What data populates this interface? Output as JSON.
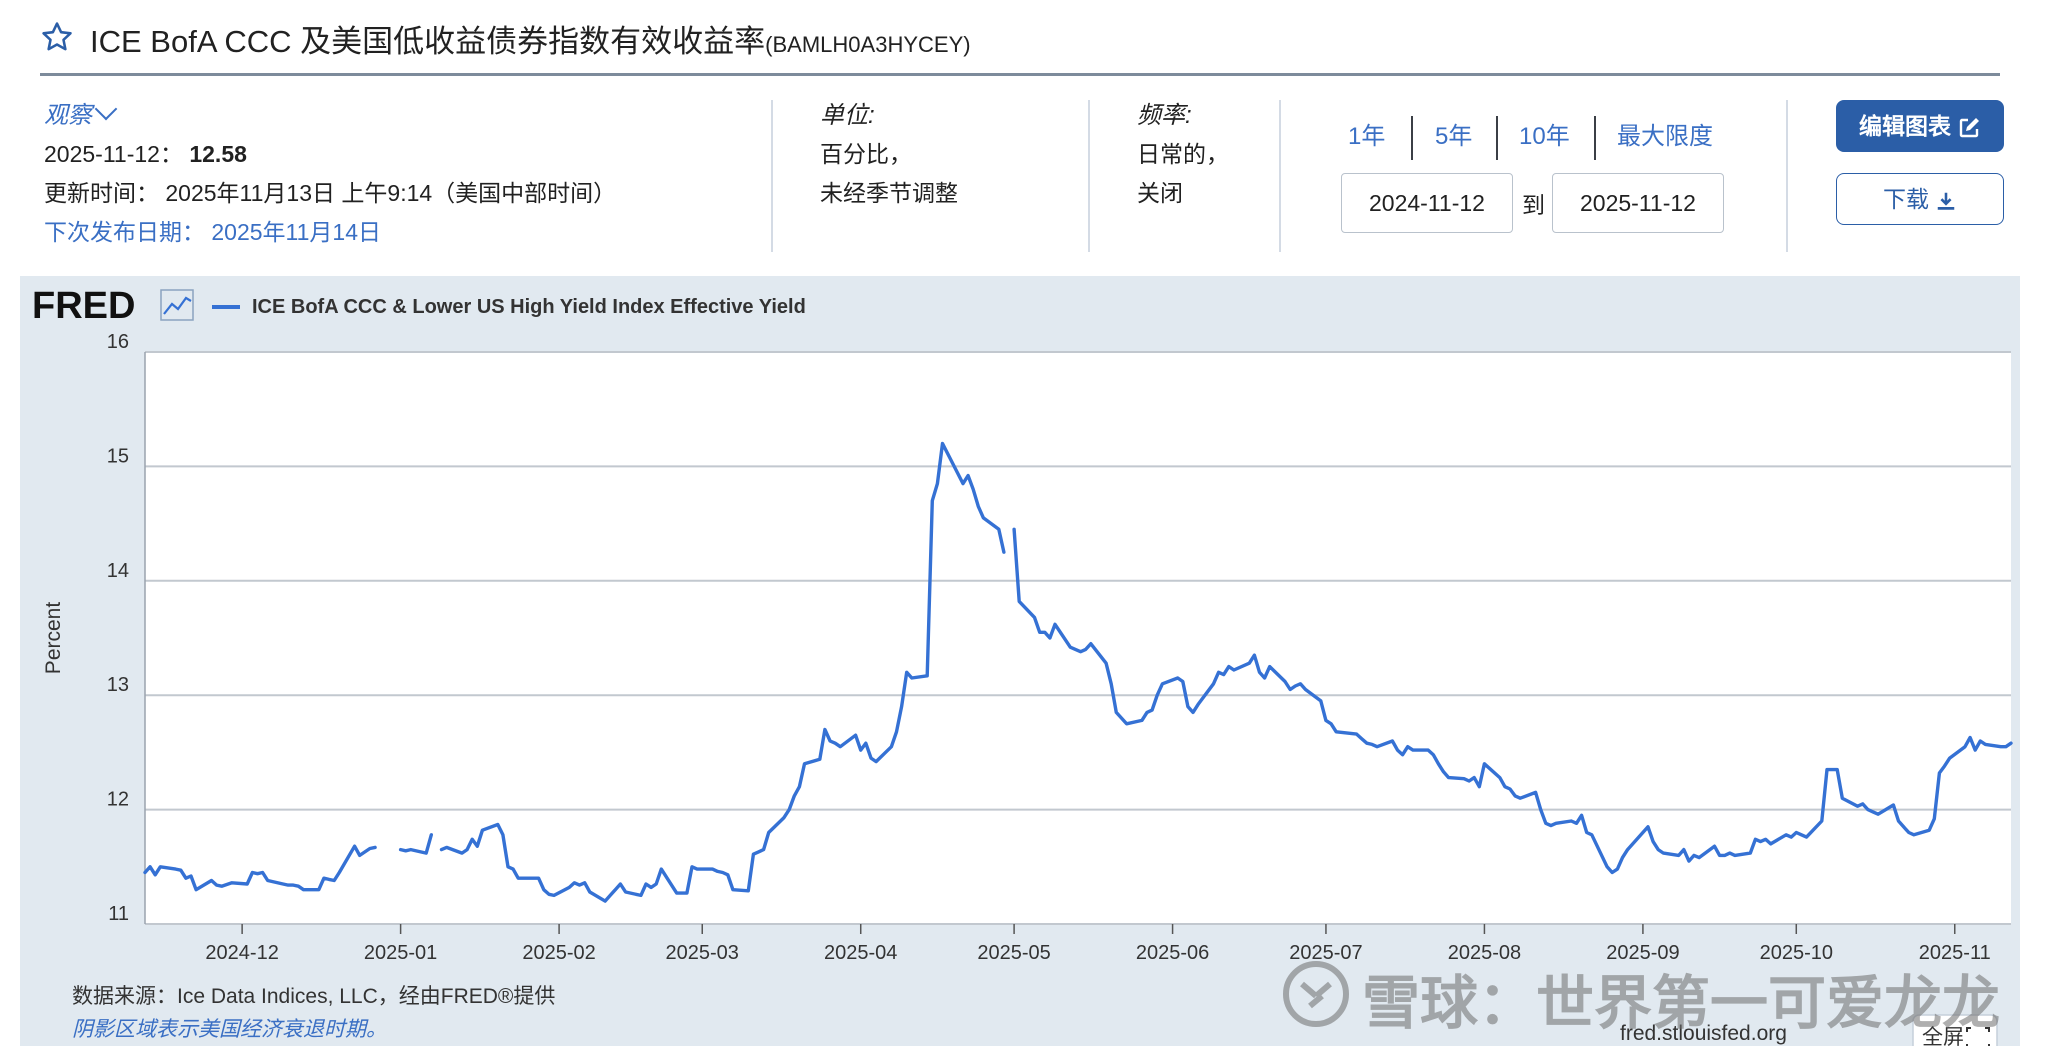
{
  "header": {
    "title": "ICE BofA CCC 及美国低收益债券指数有效收益率",
    "series_id": "(BAMLH0A3HYCEY)"
  },
  "observation": {
    "label": "观察",
    "date": "2025-11-12",
    "value": "12.58",
    "updated_label": "更新时间：",
    "updated_value": "2025年11月13日 上午9:14（美国中部时间）",
    "next_release_label": "下次发布日期：",
    "next_release_value": "2025年11月14日"
  },
  "units": {
    "label": "单位:",
    "line1": "百分比，",
    "line2": "未经季节调整"
  },
  "frequency": {
    "label": "频率:",
    "line1": "日常的，",
    "line2": "关闭"
  },
  "date_range": {
    "options": [
      "1年",
      "5年",
      "10年",
      "最大限度"
    ],
    "start": "2024-11-12",
    "to_label": "到",
    "end": "2025-11-12"
  },
  "buttons": {
    "edit": "编辑图表",
    "download": "下载"
  },
  "footer": {
    "source": "数据来源：Ice Data Indices, LLC，经由FRED®提供",
    "recession_note": "阴影区域表示美国经济衰退时期。",
    "site": "fred.stlouisfed.org",
    "fullscreen": "全屏"
  },
  "watermark": "雪球：世界第一可爱龙龙",
  "colors": {
    "line": "#3571d4",
    "accent": "#2b5ea7",
    "panel": "#e1e9f0",
    "link": "#3a6fc4"
  },
  "chart_data": {
    "type": "line",
    "brand": "FRED",
    "series": [
      {
        "name": "ICE BofA CCC & Lower US High Yield Index Effective Yield",
        "points": [
          [
            "2024-11-12",
            11.45
          ],
          [
            "2024-11-13",
            11.5
          ],
          [
            "2024-11-14",
            11.43
          ],
          [
            "2024-11-15",
            11.5
          ],
          [
            "2024-11-18",
            11.48
          ],
          [
            "2024-11-19",
            11.47
          ],
          [
            "2024-11-20",
            11.4
          ],
          [
            "2024-11-21",
            11.42
          ],
          [
            "2024-11-22",
            11.3
          ],
          [
            "2024-11-25",
            11.38
          ],
          [
            "2024-11-26",
            11.34
          ],
          [
            "2024-11-27",
            11.33
          ],
          [
            "2024-11-29",
            11.36
          ],
          [
            "2024-12-02",
            11.35
          ],
          [
            "2024-12-03",
            11.45
          ],
          [
            "2024-12-04",
            11.44
          ],
          [
            "2024-12-05",
            11.45
          ],
          [
            "2024-12-06",
            11.38
          ],
          [
            "2024-12-09",
            11.35
          ],
          [
            "2024-12-10",
            11.34
          ],
          [
            "2024-12-11",
            11.34
          ],
          [
            "2024-12-12",
            11.33
          ],
          [
            "2024-12-13",
            11.3
          ],
          [
            "2024-12-16",
            11.3
          ],
          [
            "2024-12-17",
            11.4
          ],
          [
            "2024-12-18",
            11.39
          ],
          [
            "2024-12-19",
            11.38
          ],
          [
            "2024-12-20",
            11.45
          ],
          [
            "2024-12-23",
            11.68
          ],
          [
            "2024-12-24",
            11.6
          ],
          [
            "2024-12-26",
            11.66
          ],
          [
            "2024-12-27",
            11.67
          ],
          [
            "2024-12-30",
            null
          ],
          [
            "2025-01-01",
            11.65
          ],
          [
            "2025-01-02",
            11.64
          ],
          [
            "2025-01-03",
            11.65
          ],
          [
            "2025-01-06",
            11.62
          ],
          [
            "2025-01-07",
            11.78
          ],
          [
            "2025-01-08",
            null
          ],
          [
            "2025-01-09",
            11.65
          ],
          [
            "2025-01-10",
            11.67
          ],
          [
            "2025-01-13",
            11.62
          ],
          [
            "2025-01-14",
            11.65
          ],
          [
            "2025-01-15",
            11.74
          ],
          [
            "2025-01-16",
            11.68
          ],
          [
            "2025-01-17",
            11.82
          ],
          [
            "2025-01-20",
            11.87
          ],
          [
            "2025-01-21",
            11.78
          ],
          [
            "2025-01-22",
            11.5
          ],
          [
            "2025-01-23",
            11.48
          ],
          [
            "2025-01-24",
            11.4
          ],
          [
            "2025-01-27",
            11.4
          ],
          [
            "2025-01-28",
            11.4
          ],
          [
            "2025-01-29",
            11.3
          ],
          [
            "2025-01-30",
            11.26
          ],
          [
            "2025-01-31",
            11.25
          ],
          [
            "2025-02-03",
            11.32
          ],
          [
            "2025-02-04",
            11.36
          ],
          [
            "2025-02-05",
            11.34
          ],
          [
            "2025-02-06",
            11.36
          ],
          [
            "2025-02-07",
            11.28
          ],
          [
            "2025-02-10",
            11.2
          ],
          [
            "2025-02-11",
            11.25
          ],
          [
            "2025-02-12",
            11.3
          ],
          [
            "2025-02-13",
            11.35
          ],
          [
            "2025-02-14",
            11.28
          ],
          [
            "2025-02-17",
            11.25
          ],
          [
            "2025-02-18",
            11.35
          ],
          [
            "2025-02-19",
            11.32
          ],
          [
            "2025-02-20",
            11.35
          ],
          [
            "2025-02-21",
            11.48
          ],
          [
            "2025-02-24",
            11.27
          ],
          [
            "2025-02-25",
            11.27
          ],
          [
            "2025-02-26",
            11.27
          ],
          [
            "2025-02-27",
            11.5
          ],
          [
            "2025-02-28",
            11.48
          ],
          [
            "2025-03-03",
            11.48
          ],
          [
            "2025-03-04",
            11.46
          ],
          [
            "2025-03-05",
            11.45
          ],
          [
            "2025-03-06",
            11.43
          ],
          [
            "2025-03-07",
            11.3
          ],
          [
            "2025-03-10",
            11.29
          ],
          [
            "2025-03-11",
            11.61
          ],
          [
            "2025-03-12",
            11.63
          ],
          [
            "2025-03-13",
            11.65
          ],
          [
            "2025-03-14",
            11.8
          ],
          [
            "2025-03-17",
            11.93
          ],
          [
            "2025-03-18",
            12.0
          ],
          [
            "2025-03-19",
            12.12
          ],
          [
            "2025-03-20",
            12.2
          ],
          [
            "2025-03-21",
            12.4
          ],
          [
            "2025-03-24",
            12.44
          ],
          [
            "2025-03-25",
            12.7
          ],
          [
            "2025-03-26",
            12.6
          ],
          [
            "2025-03-27",
            12.58
          ],
          [
            "2025-03-28",
            12.55
          ],
          [
            "2025-03-31",
            12.65
          ],
          [
            "2025-04-01",
            12.52
          ],
          [
            "2025-04-02",
            12.58
          ],
          [
            "2025-04-03",
            12.45
          ],
          [
            "2025-04-04",
            12.42
          ],
          [
            "2025-04-07",
            12.55
          ],
          [
            "2025-04-08",
            12.68
          ],
          [
            "2025-04-09",
            12.9
          ],
          [
            "2025-04-10",
            13.2
          ],
          [
            "2025-04-11",
            13.15
          ],
          [
            "2025-04-14",
            13.17
          ],
          [
            "2025-04-15",
            14.7
          ],
          [
            "2025-04-16",
            14.85
          ],
          [
            "2025-04-17",
            15.2
          ],
          [
            "2025-04-21",
            14.85
          ],
          [
            "2025-04-22",
            14.92
          ],
          [
            "2025-04-23",
            14.8
          ],
          [
            "2025-04-24",
            14.65
          ],
          [
            "2025-04-25",
            14.55
          ],
          [
            "2025-04-28",
            14.45
          ],
          [
            "2025-04-29",
            14.25
          ],
          [
            "2025-04-30",
            null
          ],
          [
            "2025-05-01",
            14.45
          ],
          [
            "2025-05-02",
            13.82
          ],
          [
            "2025-05-05",
            13.68
          ],
          [
            "2025-05-06",
            13.55
          ],
          [
            "2025-05-07",
            13.55
          ],
          [
            "2025-05-08",
            13.5
          ],
          [
            "2025-05-09",
            13.62
          ],
          [
            "2025-05-12",
            13.42
          ],
          [
            "2025-05-13",
            13.4
          ],
          [
            "2025-05-14",
            13.38
          ],
          [
            "2025-05-15",
            13.4
          ],
          [
            "2025-05-16",
            13.45
          ],
          [
            "2025-05-19",
            13.28
          ],
          [
            "2025-05-20",
            13.1
          ],
          [
            "2025-05-21",
            12.85
          ],
          [
            "2025-05-22",
            12.8
          ],
          [
            "2025-05-23",
            12.75
          ],
          [
            "2025-05-26",
            12.78
          ],
          [
            "2025-05-27",
            12.85
          ],
          [
            "2025-05-28",
            12.87
          ],
          [
            "2025-05-29",
            13.0
          ],
          [
            "2025-05-30",
            13.1
          ],
          [
            "2025-06-02",
            13.15
          ],
          [
            "2025-06-03",
            13.12
          ],
          [
            "2025-06-04",
            12.9
          ],
          [
            "2025-06-05",
            12.85
          ],
          [
            "2025-06-06",
            12.92
          ],
          [
            "2025-06-09",
            13.1
          ],
          [
            "2025-06-10",
            13.2
          ],
          [
            "2025-06-11",
            13.18
          ],
          [
            "2025-06-12",
            13.25
          ],
          [
            "2025-06-13",
            13.22
          ],
          [
            "2025-06-16",
            13.28
          ],
          [
            "2025-06-17",
            13.35
          ],
          [
            "2025-06-18",
            13.2
          ],
          [
            "2025-06-19",
            13.15
          ],
          [
            "2025-06-20",
            13.25
          ],
          [
            "2025-06-23",
            13.12
          ],
          [
            "2025-06-24",
            13.05
          ],
          [
            "2025-06-25",
            13.08
          ],
          [
            "2025-06-26",
            13.1
          ],
          [
            "2025-06-27",
            13.05
          ],
          [
            "2025-06-30",
            12.95
          ],
          [
            "2025-07-01",
            12.78
          ],
          [
            "2025-07-02",
            12.75
          ],
          [
            "2025-07-03",
            12.68
          ],
          [
            "2025-07-07",
            12.66
          ],
          [
            "2025-07-08",
            12.62
          ],
          [
            "2025-07-09",
            12.58
          ],
          [
            "2025-07-10",
            12.57
          ],
          [
            "2025-07-11",
            12.55
          ],
          [
            "2025-07-14",
            12.6
          ],
          [
            "2025-07-15",
            12.52
          ],
          [
            "2025-07-16",
            12.48
          ],
          [
            "2025-07-17",
            12.55
          ],
          [
            "2025-07-18",
            12.52
          ],
          [
            "2025-07-21",
            12.52
          ],
          [
            "2025-07-22",
            12.48
          ],
          [
            "2025-07-23",
            12.4
          ],
          [
            "2025-07-24",
            12.33
          ],
          [
            "2025-07-25",
            12.28
          ],
          [
            "2025-07-28",
            12.27
          ],
          [
            "2025-07-29",
            12.25
          ],
          [
            "2025-07-30",
            12.28
          ],
          [
            "2025-07-31",
            12.2
          ],
          [
            "2025-08-01",
            12.4
          ],
          [
            "2025-08-04",
            12.28
          ],
          [
            "2025-08-05",
            12.2
          ],
          [
            "2025-08-06",
            12.18
          ],
          [
            "2025-08-07",
            12.12
          ],
          [
            "2025-08-08",
            12.1
          ],
          [
            "2025-08-11",
            12.15
          ],
          [
            "2025-08-12",
            12.0
          ],
          [
            "2025-08-13",
            11.88
          ],
          [
            "2025-08-14",
            11.86
          ],
          [
            "2025-08-15",
            11.88
          ],
          [
            "2025-08-18",
            11.9
          ],
          [
            "2025-08-19",
            11.88
          ],
          [
            "2025-08-20",
            11.95
          ],
          [
            "2025-08-21",
            11.8
          ],
          [
            "2025-08-22",
            11.78
          ],
          [
            "2025-08-25",
            11.5
          ],
          [
            "2025-08-26",
            11.45
          ],
          [
            "2025-08-27",
            11.48
          ],
          [
            "2025-08-28",
            11.58
          ],
          [
            "2025-08-29",
            11.65
          ],
          [
            "2025-09-02",
            11.85
          ],
          [
            "2025-09-03",
            11.72
          ],
          [
            "2025-09-04",
            11.65
          ],
          [
            "2025-09-05",
            11.62
          ],
          [
            "2025-09-08",
            11.6
          ],
          [
            "2025-09-09",
            11.65
          ],
          [
            "2025-09-10",
            11.55
          ],
          [
            "2025-09-11",
            11.6
          ],
          [
            "2025-09-12",
            11.58
          ],
          [
            "2025-09-15",
            11.68
          ],
          [
            "2025-09-16",
            11.6
          ],
          [
            "2025-09-17",
            11.6
          ],
          [
            "2025-09-18",
            11.62
          ],
          [
            "2025-09-19",
            11.6
          ],
          [
            "2025-09-22",
            11.62
          ],
          [
            "2025-09-23",
            11.74
          ],
          [
            "2025-09-24",
            11.72
          ],
          [
            "2025-09-25",
            11.74
          ],
          [
            "2025-09-26",
            11.7
          ],
          [
            "2025-09-29",
            11.78
          ],
          [
            "2025-09-30",
            11.76
          ],
          [
            "2025-10-01",
            11.8
          ],
          [
            "2025-10-02",
            11.78
          ],
          [
            "2025-10-03",
            11.76
          ],
          [
            "2025-10-06",
            11.9
          ],
          [
            "2025-10-07",
            12.35
          ],
          [
            "2025-10-08",
            12.35
          ],
          [
            "2025-10-09",
            12.35
          ],
          [
            "2025-10-10",
            12.1
          ],
          [
            "2025-10-13",
            12.03
          ],
          [
            "2025-10-14",
            12.05
          ],
          [
            "2025-10-15",
            12.0
          ],
          [
            "2025-10-16",
            11.98
          ],
          [
            "2025-10-17",
            11.96
          ],
          [
            "2025-10-20",
            12.04
          ],
          [
            "2025-10-21",
            11.9
          ],
          [
            "2025-10-22",
            11.85
          ],
          [
            "2025-10-23",
            11.8
          ],
          [
            "2025-10-24",
            11.78
          ],
          [
            "2025-10-27",
            11.82
          ],
          [
            "2025-10-28",
            11.92
          ],
          [
            "2025-10-29",
            12.32
          ],
          [
            "2025-10-30",
            12.38
          ],
          [
            "2025-10-31",
            12.45
          ],
          [
            "2025-11-03",
            12.55
          ],
          [
            "2025-11-04",
            12.63
          ],
          [
            "2025-11-05",
            12.52
          ],
          [
            "2025-11-06",
            12.6
          ],
          [
            "2025-11-07",
            12.57
          ],
          [
            "2025-11-10",
            12.55
          ],
          [
            "2025-11-11",
            12.55
          ],
          [
            "2025-11-12",
            12.58
          ]
        ]
      }
    ],
    "x_ticks": [
      "2024-12",
      "2025-01",
      "2025-02",
      "2025-03",
      "2025-04",
      "2025-05",
      "2025-06",
      "2025-07",
      "2025-08",
      "2025-09",
      "2025-10",
      "2025-11"
    ],
    "xlim": [
      "2024-11-12",
      "2025-11-12"
    ],
    "ylabel": "Percent",
    "ylim": [
      11,
      16
    ],
    "y_ticks": [
      11,
      12,
      13,
      14,
      15,
      16
    ],
    "grid": true,
    "legend": "top-left"
  }
}
